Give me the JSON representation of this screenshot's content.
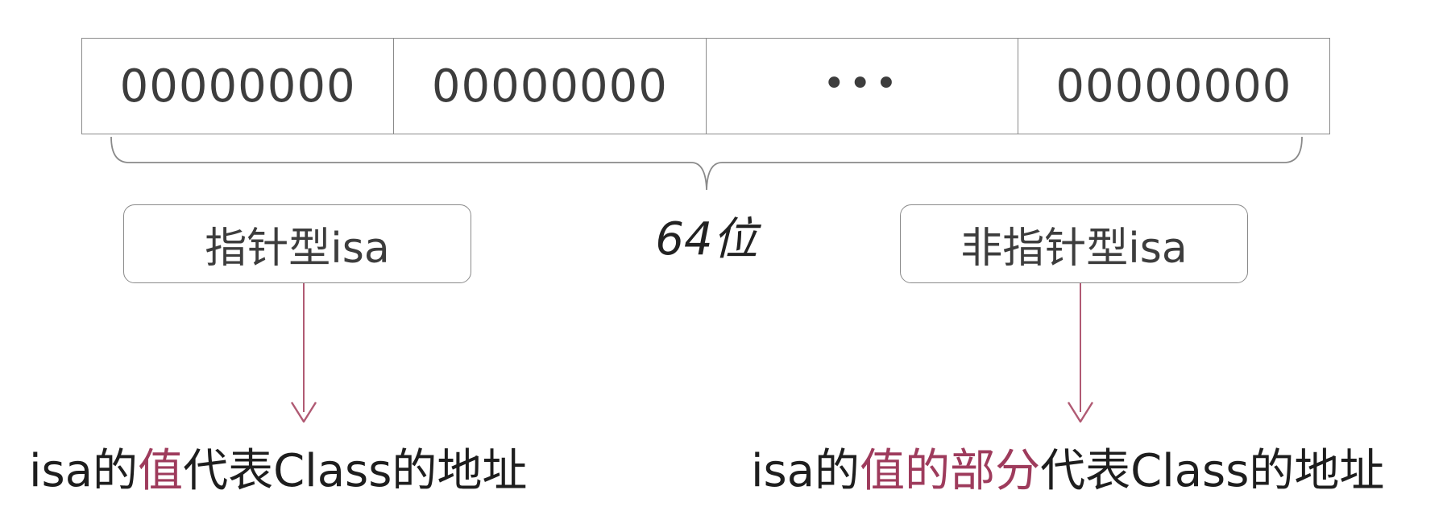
{
  "bits": {
    "cells": [
      "00000000",
      "00000000",
      "•••",
      "00000000"
    ],
    "total_label": "64位"
  },
  "left": {
    "box_label": "指针型isa",
    "desc_prefix": "isa的",
    "desc_highlight": "值",
    "desc_suffix": "代表Class的地址"
  },
  "right": {
    "box_label": "非指针型isa",
    "desc_prefix": "isa的",
    "desc_highlight": "值的部分",
    "desc_suffix": "代表Class的地址"
  },
  "colors": {
    "line": "#8a8a8a",
    "arrow": "#b05a73",
    "highlight": "#9e3b5c",
    "text": "#3d3d3d"
  }
}
